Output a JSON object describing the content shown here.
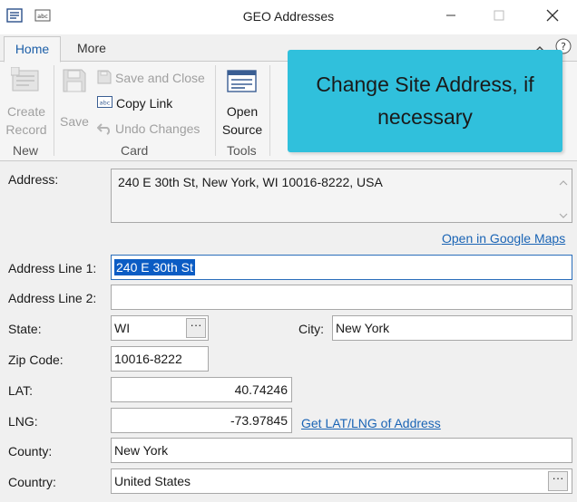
{
  "window": {
    "title": "GEO Addresses"
  },
  "tabs": [
    "Home",
    "More"
  ],
  "ribbon": {
    "new_group": {
      "create_record": [
        "Create",
        "Record"
      ],
      "label": "New"
    },
    "card_group": {
      "save": "Save",
      "save_and_close": "Save and Close",
      "copy_link": "Copy Link",
      "undo_changes": "Undo Changes",
      "label": "Card"
    },
    "tools_group": {
      "open_source": [
        "Open",
        "Source"
      ],
      "label": "Tools"
    }
  },
  "callout": {
    "lines": [
      "Change Site Address, if",
      "necessary"
    ],
    "color": "#30c0dc"
  },
  "form": {
    "address_label": "Address:",
    "address_value": "240 E 30th St, New York, WI 10016-8222, USA",
    "google_maps_link": "Open in Google Maps",
    "address_line1_label": "Address Line 1:",
    "address_line1_value": "240 E 30th St",
    "address_line2_label": "Address Line 2:",
    "address_line2_value": "",
    "state_label": "State:",
    "state_value": "WI",
    "city_label": "City:",
    "city_value": "New York",
    "zip_label": "Zip Code:",
    "zip_value": "10016-8222",
    "lat_label": "LAT:",
    "lat_value": "40.74246",
    "lng_label": "LNG:",
    "lng_value": "-73.97845",
    "get_latlng_link": "Get LAT/LNG of Address",
    "county_label": "County:",
    "county_value": "New York",
    "country_label": "Country:",
    "country_value": "United States",
    "ellipsis": "···"
  },
  "colors": {
    "accent": "#1d5fa8",
    "link": "#1a64b5",
    "selection": "#0b5cc4"
  }
}
